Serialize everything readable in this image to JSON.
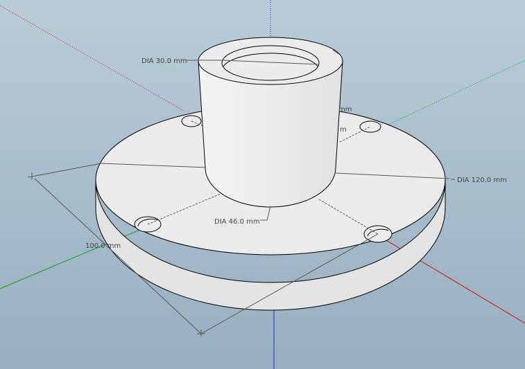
{
  "viewport": {
    "sky_top": "#b9ccd8",
    "sky_bottom": "#98afc1"
  },
  "axes": {
    "red": "#d01515",
    "green": "#12a012",
    "blue": "#2a2ad6"
  },
  "model": {
    "face_color": "#ececec",
    "side_color": "#e4e4e4",
    "edge_color": "#000000",
    "dimension_color": "#555555"
  },
  "dimensions": {
    "tube_inner": "DIA 30.0 mm",
    "tube_outer": "DIA 46.0 mm",
    "flange_outer": "DIA 120.0 mm",
    "bolt_circle": "100.0 mm",
    "hidden_label_1": "mm",
    "hidden_label_2": "m"
  }
}
